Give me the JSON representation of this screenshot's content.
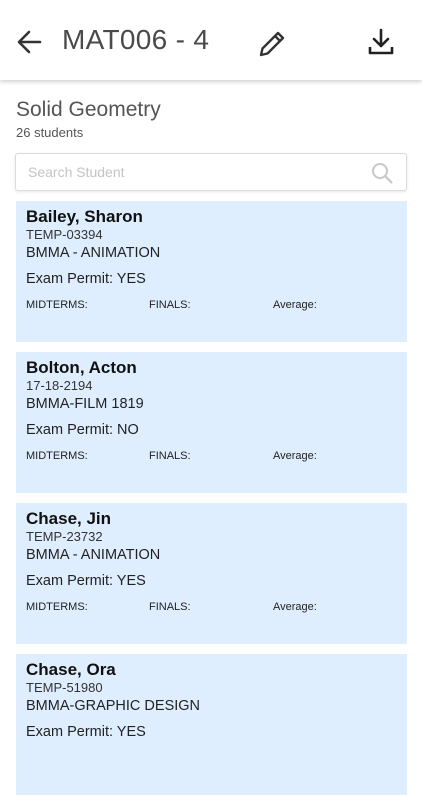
{
  "header": {
    "title": "MAT006 - 4",
    "icons": {
      "back": "arrow-left-icon",
      "edit": "pencil-icon",
      "download": "download-icon"
    }
  },
  "course": {
    "name": "Solid Geometry",
    "count": "26 students"
  },
  "search": {
    "placeholder": "Search Student",
    "value": ""
  },
  "labels": {
    "midterms": "MIDTERMS:",
    "finals": "FINALS:",
    "average": "Average:"
  },
  "students": [
    {
      "name": "Bailey, Sharon",
      "id": "TEMP-03394",
      "program": "BMMA - ANIMATION",
      "permit": "Exam Permit: YES"
    },
    {
      "name": "Bolton, Acton",
      "id": "17-18-2194",
      "program": "BMMA-FILM 1819",
      "permit": "Exam Permit: NO"
    },
    {
      "name": "Chase, Jin",
      "id": "TEMP-23732",
      "program": "BMMA - ANIMATION",
      "permit": "Exam Permit: YES"
    },
    {
      "name": "Chase, Ora",
      "id": "TEMP-51980",
      "program": "BMMA-GRAPHIC DESIGN",
      "permit": "Exam Permit: YES"
    }
  ],
  "colors": {
    "card_bg": "#dfeefe",
    "header_text": "#4a4a4a",
    "icon": "#333333"
  }
}
